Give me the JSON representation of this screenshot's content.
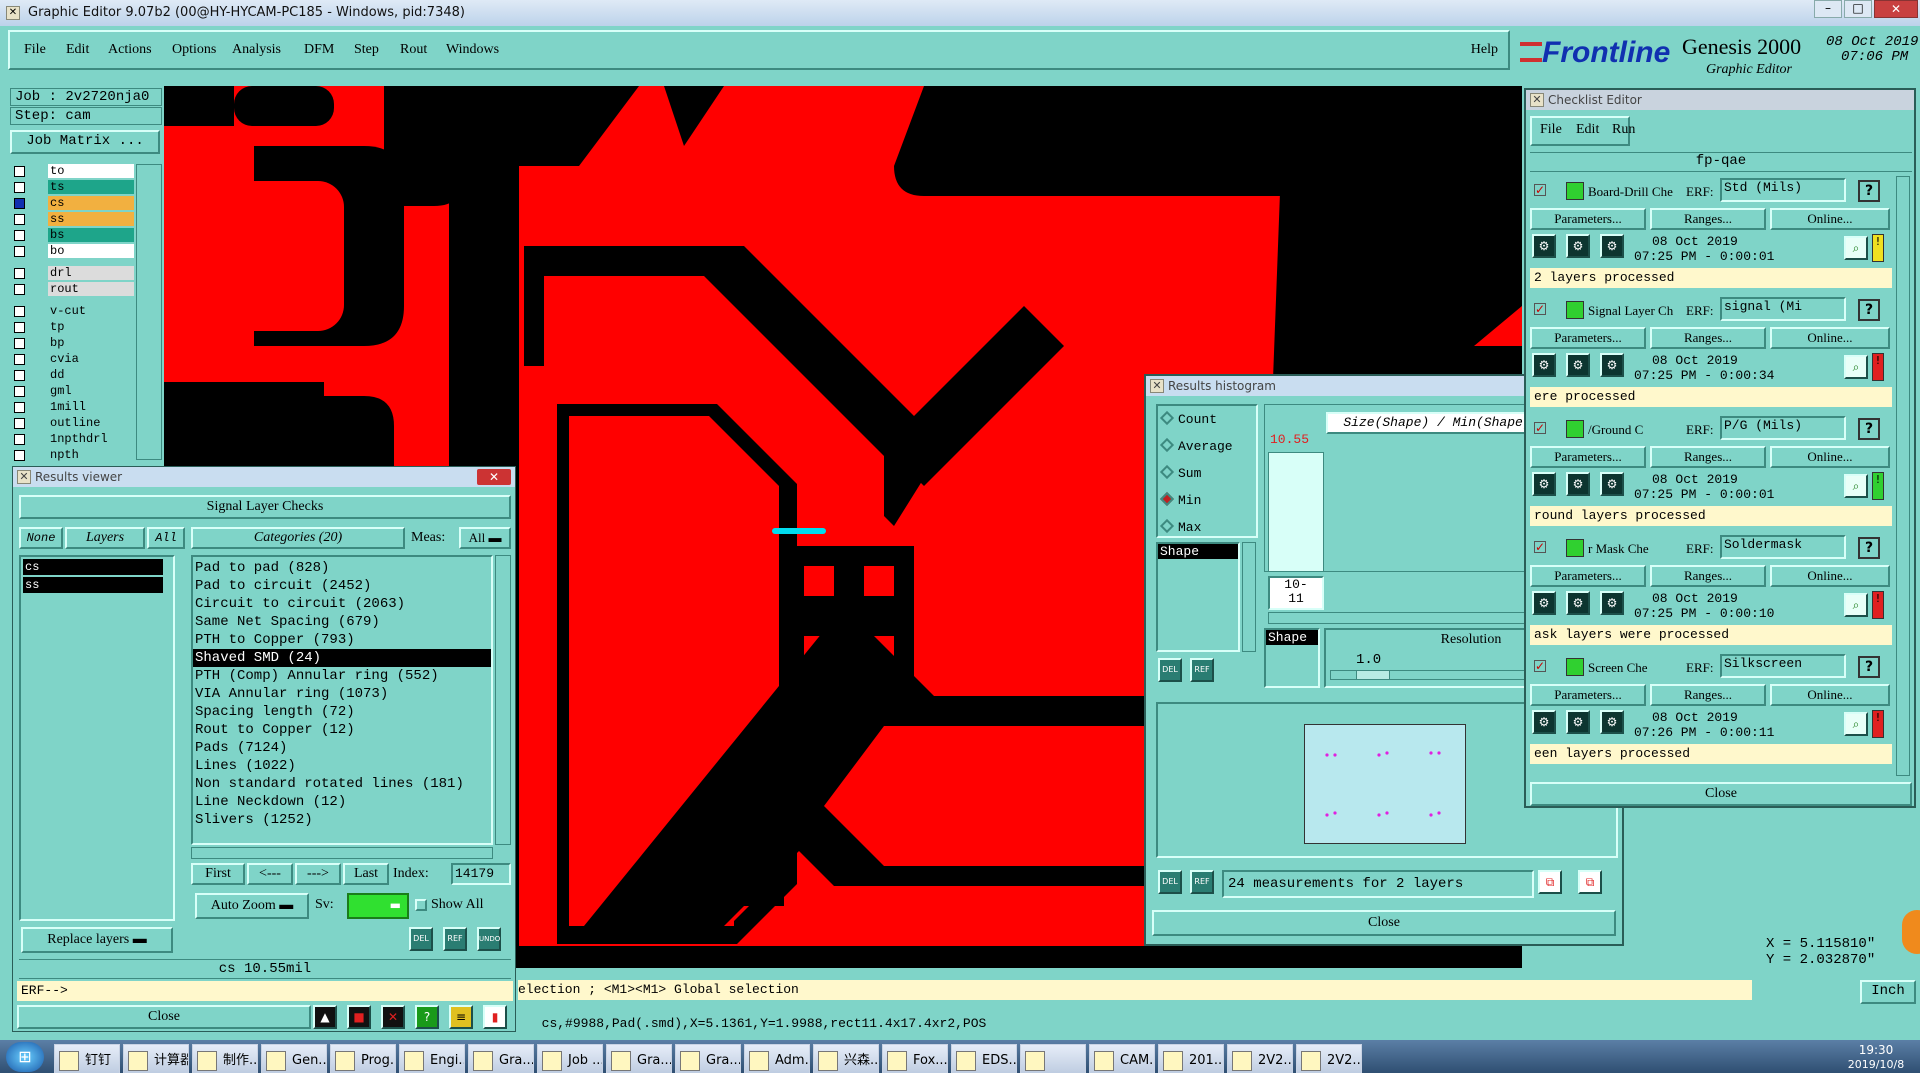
{
  "app": {
    "title": "Graphic Editor 9.07b2 (00@HY-HYCAM-PC185 - Windows, pid:7348)",
    "menu": [
      "File",
      "Edit",
      "Actions",
      "Options",
      "Analysis",
      "DFM",
      "Step",
      "Rout",
      "Windows"
    ],
    "help": "Help",
    "brand": "Frontline",
    "product": "Genesis 2000",
    "subtitle": "Graphic Editor",
    "date": "08 Oct 2019",
    "time": "07:06 PM"
  },
  "job": {
    "job_label": "Job : 2v2720nja0",
    "step_label": "Step: cam",
    "matrix_button": "Job Matrix ..."
  },
  "layers": [
    {
      "name": "to",
      "color": "#ffffff"
    },
    {
      "name": "ts",
      "color": "#1ea58a"
    },
    {
      "name": "cs",
      "color": "#f2b040",
      "active": true
    },
    {
      "name": "ss",
      "color": "#f2b040"
    },
    {
      "name": "bs",
      "color": "#1ea58a"
    },
    {
      "name": "bo",
      "color": "#ffffff"
    },
    {
      "name": "drl",
      "color": "#dcdcdc"
    },
    {
      "name": "rout",
      "color": "#dcdcdc"
    },
    {
      "name": "v-cut",
      "color": "#7fd4c8"
    },
    {
      "name": "tp",
      "color": "#7fd4c8"
    },
    {
      "name": "bp",
      "color": "#7fd4c8"
    },
    {
      "name": "cvia",
      "color": "#7fd4c8"
    },
    {
      "name": "dd",
      "color": "#7fd4c8"
    },
    {
      "name": "gml",
      "color": "#7fd4c8"
    },
    {
      "name": "1mill",
      "color": "#7fd4c8"
    },
    {
      "name": "outline",
      "color": "#7fd4c8"
    },
    {
      "name": "1npthdrl",
      "color": "#7fd4c8"
    },
    {
      "name": "npth",
      "color": "#7fd4c8"
    }
  ],
  "results_viewer": {
    "title": "Results viewer",
    "heading": "Signal Layer Checks",
    "none": "None",
    "layers_btn": "Layers",
    "all_btn": "All",
    "categories_btn": "Categories (20)",
    "meas_label": "Meas:",
    "meas_value": "All",
    "layer_items": [
      "cs",
      "ss"
    ],
    "categories": [
      "Pad to pad (828)",
      "Pad to circuit (2452)",
      "Circuit to circuit (2063)",
      "Same Net Spacing (679)",
      "PTH to Copper (793)",
      "Shaved SMD (24)",
      "PTH (Comp) Annular ring (552)",
      "VIA Annular ring (1073)",
      "Spacing length (72)",
      "Rout to Copper (12)",
      "Pads (7124)",
      "Lines (1022)",
      "Non standard rotated lines (181)",
      "Line Neckdown (12)",
      "Slivers (1252)"
    ],
    "selected_category": 5,
    "first": "First",
    "prev": "<---",
    "next": "--->",
    "last": "Last",
    "index_label": "Index:",
    "index_value": "14179",
    "auto_zoom": "Auto Zoom",
    "sv_label": "Sv:",
    "show_all": "Show All",
    "replace_layers": "Replace layers",
    "status": "cs 10.55mil",
    "erf": "ERF-->",
    "close": "Close",
    "del": "DEL",
    "ref": "REF",
    "undo": "UNDO"
  },
  "histogram": {
    "title": "Results histogram",
    "options": [
      "Count",
      "Average",
      "Sum",
      "Min",
      "Max"
    ],
    "selected_option": "Min",
    "header": "Size(Shape) / Min(Shape)",
    "bar_value": "10.55",
    "bar_fraction": 1.0,
    "range_label_1": "10-",
    "range_label_2": "11",
    "shape_list": [
      "Shape"
    ],
    "shape_label": "Shape",
    "resolution_label": "Resolution",
    "resolution_value": "1.0",
    "measurements": "24 measurements for 2 layers",
    "close": "Close"
  },
  "checklist": {
    "title": "Checklist Editor",
    "menu": [
      "File",
      "Edit",
      "Run"
    ],
    "name": "fp-qae",
    "erf_label": "ERF:",
    "params": "Parameters...",
    "ranges": "Ranges...",
    "online": "Online...",
    "checks": [
      {
        "name": "Board-Drill Che",
        "erf": "Std (Mils)",
        "date": "08 Oct 2019",
        "time": "07:25 PM - 0:00:01",
        "status": "2 layers processed",
        "flag": "#f0e020"
      },
      {
        "name": "Signal Layer Ch",
        "erf": "signal (Mi",
        "date": "08 Oct 2019",
        "time": "07:25 PM - 0:00:34",
        "status": "ere processed",
        "flag": "#e02020"
      },
      {
        "name": "/Ground C",
        "erf": "P/G (Mils)",
        "date": "08 Oct 2019",
        "time": "07:25 PM - 0:00:01",
        "status": "round layers processed",
        "flag": "#30d030"
      },
      {
        "name": "r Mask Che",
        "erf": "Soldermask",
        "date": "08 Oct 2019",
        "time": "07:25 PM - 0:00:10",
        "status": "ask layers were processed",
        "flag": "#e02020"
      },
      {
        "name": "Screen Che",
        "erf": "Silkscreen",
        "date": "08 Oct 2019",
        "time": "07:26 PM - 0:00:11",
        "status": "een layers processed",
        "flag": "#e02020"
      }
    ],
    "close": "Close"
  },
  "status": {
    "message": "election ; <M1><M1> Global selection",
    "bottom": "cs,#9988,Pad(.smd),X=5.1361,Y=1.9988,rect11.4x17.4xr2,POS",
    "x": "X = 5.115810\"",
    "y": "Y = 2.032870\"",
    "units": "Inch"
  },
  "taskbar": {
    "items": [
      "钉钉",
      "计算器",
      "制作...",
      "Gen...",
      "Prog...",
      "Engi...",
      "Gra...",
      "Job ...",
      "Gra...",
      "Gra...",
      "Adm...",
      "兴森...",
      "Fox...",
      "EDS...",
      "",
      "CAM...",
      "201...",
      "2V2...",
      "2V2..."
    ],
    "clock_time": "19:30",
    "clock_date": "2019/10/8"
  },
  "colors": {
    "copper": "#ff0000",
    "background": "#000000",
    "panel": "#7fd4c8",
    "highlight": "#00ddf0"
  }
}
